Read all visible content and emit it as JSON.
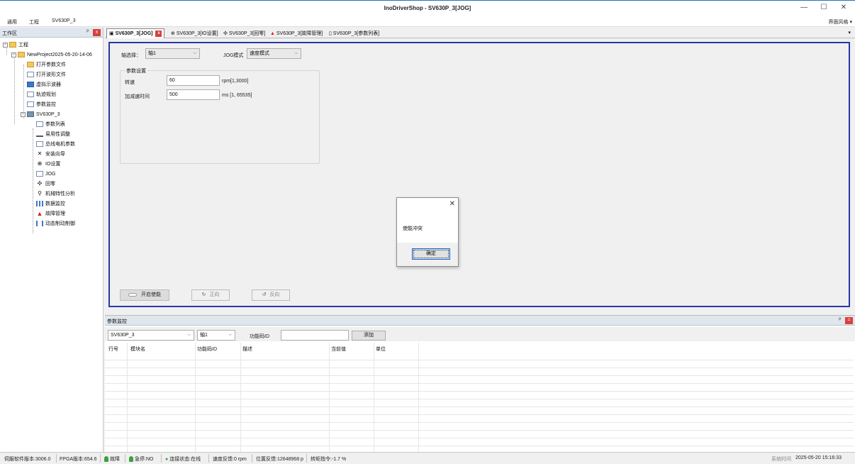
{
  "window": {
    "title": "InoDriverShop - SV630P_3[JOG]",
    "minimize": "—",
    "maximize": "☐",
    "close": "✕"
  },
  "menubar": {
    "items": [
      "通用",
      "工程",
      "SV630P_3"
    ],
    "style_menu": "界面风格 ▾"
  },
  "workspace": {
    "title": "工作区",
    "pin": "ᵖ",
    "close": "x",
    "tree": {
      "root": "工程",
      "project": "NewProject2025-05-20-14-06",
      "project_items": [
        "打开参数文件",
        "打开波形文件",
        "虚拟示波器",
        "轨迹规划",
        "参数监控"
      ],
      "device": "SV630P_3",
      "device_items": [
        "参数列表",
        "易用性调整",
        "总线电机参数",
        "安装向导",
        "IO设置",
        "JOG",
        "回零",
        "机械特性分析",
        "数据监控",
        "故障管理",
        "动态制动制御"
      ]
    }
  },
  "tabs": [
    {
      "label": "SV630P_3[JOG]",
      "active": true
    },
    {
      "label": "SV630P_3[IO设置]",
      "active": false
    },
    {
      "label": "SV630P_3[回零]",
      "active": false
    },
    {
      "label": "SV630P_3[故障管理]",
      "active": false
    },
    {
      "label": "SV630P_3[参数列表]",
      "active": false
    }
  ],
  "tab_dropdown": "▾",
  "jog": {
    "axis_label": "轴选择：",
    "axis_value": "轴1",
    "mode_label": "JOG模式",
    "mode_value": "速度模式",
    "group_title": "参数设置",
    "speed_label": "转速",
    "speed_value": "60",
    "speed_unit": "rpm[1,3000]",
    "accel_label": "加减速时间",
    "accel_value": "500",
    "accel_unit": "ms [1, 65535]",
    "enable_button": "开启使能",
    "forward_button": "正向",
    "reverse_button": "反向"
  },
  "dialog": {
    "message": "使能冲突",
    "ok": "确定",
    "close": "✕"
  },
  "monitor": {
    "title": "参数监控",
    "device_select": "SV630P_3",
    "axis_select": "轴1",
    "code_label": "功能码ID",
    "code_value": "",
    "add_button": "添加",
    "columns": [
      "行号",
      "模块名",
      "功能码ID",
      "描述",
      "当前值",
      "单位"
    ]
  },
  "statusbar": {
    "servo_version": "伺服软件版本:3006.0",
    "fpga_version": "FPGA版本:654.6",
    "fault": "故障",
    "estop": "急停:NO",
    "connection": "连接状态:在线",
    "speed_feedback": "速度反馈:0 rpm",
    "position_feedback": "位置反馈:12648968 p",
    "torque_command": "转矩指令:-1.7 %",
    "system_time_label": "系统时间",
    "system_time": "2025-05-20 15:16:33"
  },
  "colors": {
    "accent_blue": "#2838a8",
    "close_red": "#d9403a",
    "status_green": "#3aa33a"
  }
}
